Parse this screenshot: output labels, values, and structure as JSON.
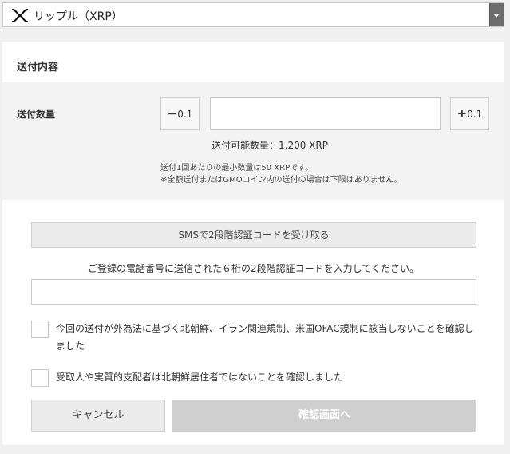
{
  "currency": {
    "icon": "xrp-icon",
    "label": "リップル（XRP）"
  },
  "form": {
    "section_title": "送付内容",
    "amount_label": "送付数量",
    "minus_step": "0.1",
    "plus_step": "0.1",
    "minus_sign": "−",
    "plus_sign": "+",
    "amount_value": "",
    "available": "送付可能数量：1,200 XRP",
    "note_min": "送付1回あたりの最小数量は50 XRPです。",
    "note_full": "※全額送付またはGMOコイン内の送付の場合は下限はありません。"
  },
  "verification": {
    "sms_button": "SMSで2段階認証コードを受け取る",
    "instruction": "ご登録の電話番号に送信された６桁の2段階認証コードを入力してください。",
    "code_value": ""
  },
  "confirmations": {
    "item1": "今回の送付が外為法に基づく北朝鮮、イラン関連規制、米国OFAC規制に該当しないことを確認しました",
    "item2": "受取人や実質的支配者は北朝鮮居住者ではないことを確認しました",
    "item1_checked": false,
    "item2_checked": false
  },
  "actions": {
    "cancel": "キャンセル",
    "confirm": "確認画面へ"
  },
  "colors": {
    "disabled_button": "#cfcfcf",
    "select_arrow_bg": "#6d6d6d",
    "panel_bg": "#f3f3f3"
  }
}
